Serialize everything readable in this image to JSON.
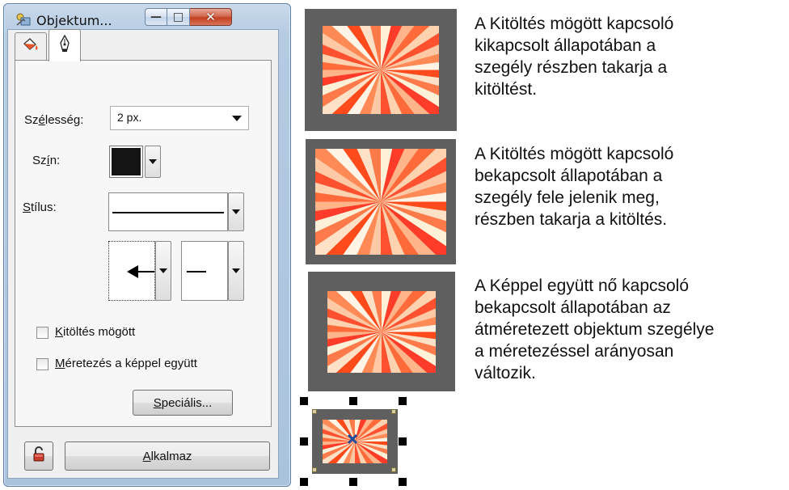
{
  "window": {
    "title": "Objektum...",
    "buttons": {
      "minimize": "—",
      "maximize": "□",
      "close": "✕"
    }
  },
  "tabs": [
    {
      "icon": "paint-bucket-icon",
      "active": false
    },
    {
      "icon": "pen-nib-icon",
      "active": true
    }
  ],
  "line_properties": {
    "width_label_pre": "Sz",
    "width_label_key": "é",
    "width_label_post": "lesség:",
    "width_value": "2 px.",
    "color_label_pre": "Sz",
    "color_label_key": "í",
    "color_label_post": "n:",
    "color_value": "#141414",
    "style_label_key": "S",
    "style_label_post": "tílus:"
  },
  "checkboxes": {
    "fill_behind_key": "K",
    "fill_behind_rest": "itöltés mögött",
    "fill_behind_checked": false,
    "scale_with_image_key": "M",
    "scale_with_image_rest": "éretezés a képpel együtt",
    "scale_with_image_checked": false
  },
  "buttons": {
    "special_key": "S",
    "special_rest": "peciális...",
    "apply_key": "A",
    "apply_rest": "lkalmaz"
  },
  "descriptions": [
    "A Kitöltés mögött kapcsoló\nkikapcsolt állapotában a\nszegély részben takarja a\nkitöltést.",
    "A Kitöltés mögött kapcsoló\nbekapcsolt állapotában a\nszegély fele jelenik meg,\nrészben takarja a kitöltés.",
    "A Képpel együtt nő kapcsoló\nbekapcsolt állapotában az\nátméretezett objektum szegélye\na méretezéssel arányosan\nváltozik."
  ],
  "colors": {
    "frame": "#5f5f5f",
    "burst_dark": "#ff5a2a",
    "burst_light": "#ffcfb0",
    "accent_window": "#b5cbe2"
  }
}
